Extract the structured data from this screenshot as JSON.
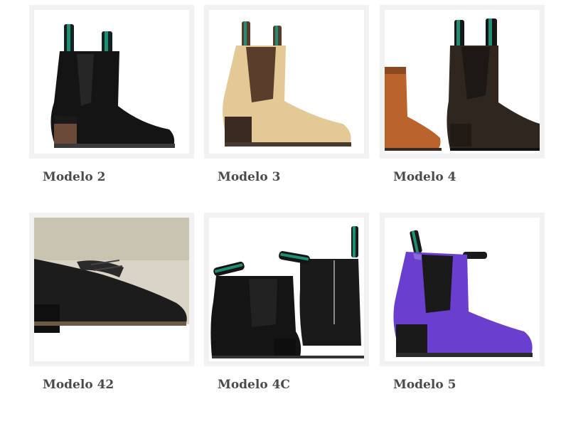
{
  "products": [
    {
      "label": "Modelo 2",
      "image": "black-suede-boot"
    },
    {
      "label": "Modelo 3",
      "image": "beige-leather-boot"
    },
    {
      "label": "Modelo 4",
      "image": "brown-and-dark-boots"
    },
    {
      "label": "Modelo 42",
      "image": "black-laced-shoe"
    },
    {
      "label": "Modelo 4C",
      "image": "black-zip-boots"
    },
    {
      "label": "Modelo 5",
      "image": "purple-leather-boot"
    }
  ],
  "colors": {
    "card_frame": "#f2f2f2",
    "label_text": "#4a4a4a",
    "pull_tab_green": "#1f8f74",
    "boot_purple": "#6a3fd0",
    "boot_beige": "#e3c995",
    "boot_tan": "#b8642a"
  }
}
